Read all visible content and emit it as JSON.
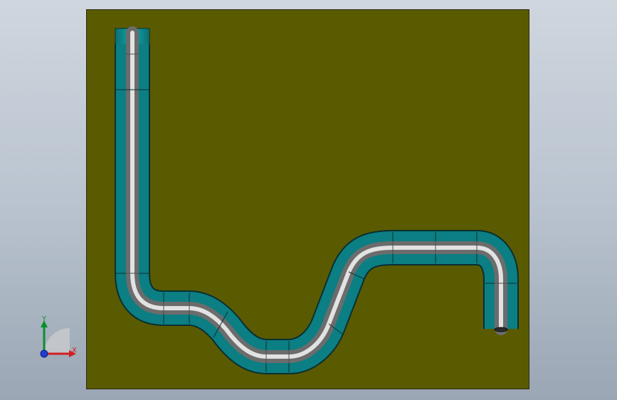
{
  "colors": {
    "background_top": "#cfd6de",
    "background_bottom": "#9aa6b4",
    "plate": "#5a5a00",
    "channel": "#0b7f83",
    "channel_edge": "#0a2f32",
    "pipe_dark": "#7a7a7a",
    "pipe_light": "#f2f2f2",
    "triad_x": "#d11f1f",
    "triad_y": "#0b8f2d",
    "triad_z": "#1f3fd1"
  },
  "triad": {
    "x_label": "X",
    "y_label": "Y"
  }
}
